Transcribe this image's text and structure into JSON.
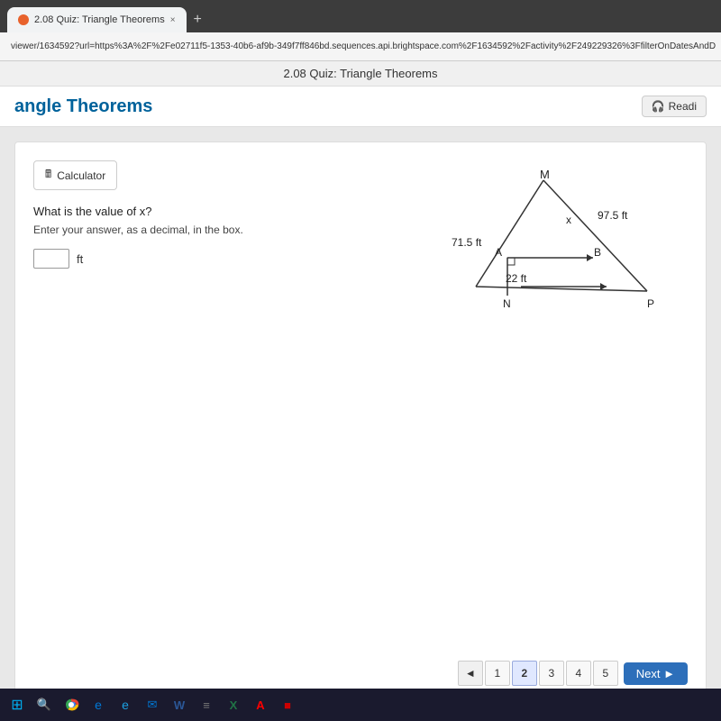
{
  "browser": {
    "tab_label": "2.08 Quiz: Triangle Theorems",
    "tab_close": "×",
    "tab_new": "+",
    "address_url": "viewer/1634592?url=https%3A%2F%2Fe02711f5-1353-40b6-af9b-349f7ff846bd.sequences.api.brightspace.com%2F1634592%2Factivity%2F249229326%3FfilterOnDatesAndD"
  },
  "page_title": "2.08 Quiz: Triangle Theorems",
  "header": {
    "title": "angle Theorems",
    "reading_btn": "Readi"
  },
  "quiz": {
    "calculator_btn": "Calculator",
    "question_text": "What is the value of x?",
    "question_instruction": "Enter your answer, as a decimal, in the box.",
    "answer_unit": "ft",
    "answer_placeholder": ""
  },
  "diagram": {
    "label_M": "M",
    "label_A": "A",
    "label_B": "B",
    "label_N": "N",
    "label_P": "P",
    "label_x": "x",
    "side_975": "97.5 ft",
    "side_715": "71.5 ft",
    "side_22": "22 ft"
  },
  "pagination": {
    "prev_symbol": "◄",
    "pages": [
      "1",
      "2",
      "3",
      "4",
      "5"
    ],
    "active_page": "2",
    "next_label": "Next ►"
  },
  "taskbar": {
    "icons": [
      "⊞",
      "🔍",
      "●",
      "e",
      "e",
      "✉",
      "W",
      "≡",
      "X",
      "A",
      "■"
    ]
  }
}
